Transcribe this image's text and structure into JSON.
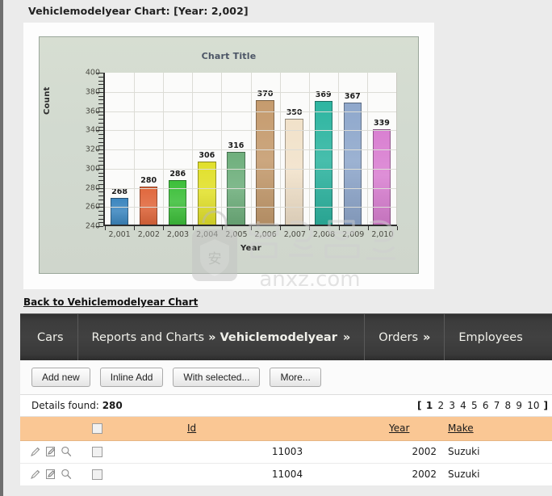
{
  "report": {
    "title": "Vehiclemodelyear Chart: [Year: 2,002]",
    "back_link": "Back to Vehiclemodelyear Chart"
  },
  "chart_data": {
    "type": "bar",
    "title": "Chart Title",
    "xlabel": "Year",
    "ylabel": "Count",
    "ylim": [
      240,
      400
    ],
    "ytick_step": 20,
    "yticks": [
      "400",
      "380",
      "360",
      "340",
      "320",
      "300",
      "280",
      "260",
      "240"
    ],
    "grid": true,
    "legend": "none",
    "categories": [
      "2,001",
      "2,002",
      "2,003",
      "2,004",
      "2,005",
      "2,006",
      "2,007",
      "2,008",
      "2,009",
      "2,010"
    ],
    "values": [
      268,
      280,
      286,
      306,
      316,
      370,
      350,
      369,
      367,
      339
    ],
    "bar_colors": [
      "#3c86bf",
      "#e0673c",
      "#3dbf3a",
      "#e1e02b",
      "#6faf7c",
      "#c59b6e",
      "#f1e2ca",
      "#2eb5a1",
      "#8fa8cc",
      "#d980d1"
    ]
  },
  "navbar": {
    "items": [
      {
        "label": "Cars",
        "chevron": ""
      },
      {
        "label": "Reports and Charts",
        "chevron": "»",
        "current": "Vehiclemodelyear",
        "chevron2": "»"
      },
      {
        "label": "Orders",
        "chevron": "»"
      },
      {
        "label": "Employees",
        "chevron": ""
      }
    ]
  },
  "toolbar": {
    "buttons": [
      "Add new",
      "Inline Add",
      "With selected...",
      "More..."
    ]
  },
  "details": {
    "label": "Details found:",
    "count": "280",
    "pager": {
      "open": "[",
      "close": "]",
      "pages": [
        "1",
        "2",
        "3",
        "4",
        "5",
        "6",
        "7",
        "8",
        "9",
        "10"
      ],
      "current": "1"
    }
  },
  "table": {
    "headers": {
      "id": "Id",
      "year": "Year",
      "make": "Make"
    },
    "rows": [
      {
        "id": "11003",
        "year": "2002",
        "make": "Suzuki"
      },
      {
        "id": "11004",
        "year": "2002",
        "make": "Suzuki"
      }
    ]
  },
  "watermark": {
    "text": "anxz.com",
    "badge_char": "安"
  }
}
